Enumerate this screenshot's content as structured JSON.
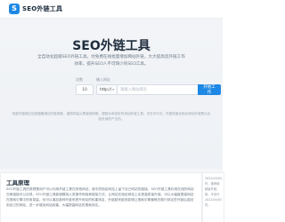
{
  "header": {
    "logo_glyph": "S",
    "logo_text": "SEO外链工具"
  },
  "hero": {
    "title": "SEO外链工具",
    "description": "全自动化超级SEO外链工具，付免费在线批量增加网站外链，大大提高您外链工作效率，提升SEO人不可缺少的SEO工具。",
    "count_label": "次数",
    "url_label": "输入网址",
    "count_value": "10",
    "protocol": "http://",
    "url_placeholder": "请输入网站域名",
    "submit_label": "开始工作",
    "notice": "热盘外链超过百链整篇增加外链收取，谨慎抑益从群量指收取，提链为系统定时添加外链工具，无在中中文，外国或者比较比网站外链是从比较外部的产生的。"
  },
  "principle": {
    "title": "工具原理",
    "body": "SEO外链工具的原理是用户可以利用外链工具在其他网站，就中的指定网站上留下自己网站的链接。SEO外链工具利用在线的网站交换链接可以实现，SEO外链工具能够模拟人类操作和各种链接方式，让网站在指定网站上实现高质量外链。可以大幅度提高网站在搜索引擎中的收录量，也可以增加各种外链来提升网站的权重排名，外链越来越多能够让搜索引擎蜘蛛在爬行到这些外链后返回到自己的网站，进一步增加网站权重，大幅提高网站的搜索排名。"
  },
  "sidebar": {
    "lines": [
      "2022/03/05",
      "作，推荐使",
      "超级外链，",
      "接，手动分",
      "2022/04/05",
      "内。"
    ]
  }
}
